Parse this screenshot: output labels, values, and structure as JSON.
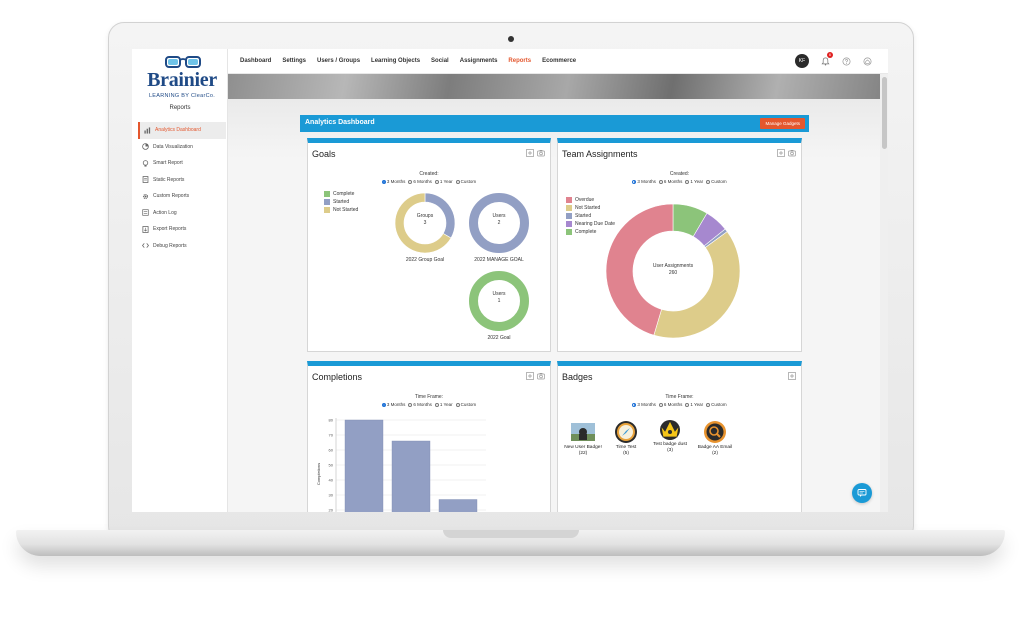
{
  "brand": {
    "name": "Brainier",
    "tagline": "LEARNING BY ClearCo."
  },
  "sidebar": {
    "title": "Reports",
    "items": [
      {
        "label": "Analytics Dashboard",
        "icon": "bar-chart-icon",
        "active": true
      },
      {
        "label": "Data Visualization",
        "icon": "pie-chart-icon"
      },
      {
        "label": "Smart Report",
        "icon": "lightbulb-icon"
      },
      {
        "label": "Static Reports",
        "icon": "document-icon"
      },
      {
        "label": "Custom Reports",
        "icon": "gear-icon"
      },
      {
        "label": "Action Log",
        "icon": "list-icon"
      },
      {
        "label": "Export Reports",
        "icon": "export-icon"
      },
      {
        "label": "Debug Reports",
        "icon": "code-icon"
      }
    ]
  },
  "nav": {
    "items": [
      "Dashboard",
      "Settings",
      "Users / Groups",
      "Learning Objects",
      "Social",
      "Assignments",
      "Reports",
      "Ecommerce"
    ],
    "active": "Reports",
    "avatar_initials": "KF",
    "notification_count": "6"
  },
  "dashboard": {
    "title": "Analytics Dashboard",
    "manage_label": "Manage Gadgets"
  },
  "goals": {
    "title": "Goals",
    "filter_label": "Created:",
    "filters": [
      "3 Months",
      "6 Months",
      "1 Year",
      "Custom"
    ],
    "legend": [
      {
        "label": "Complete",
        "color": "#8cc47a"
      },
      {
        "label": "Started",
        "color": "#929fc4"
      },
      {
        "label": "Not Started",
        "color": "#ddcc8a"
      }
    ],
    "donuts": [
      {
        "center_label": "Groups",
        "center_value": "3",
        "caption": "2022 Group Goal",
        "segments": [
          {
            "color": "#929fc4",
            "value": 1
          },
          {
            "color": "#ddcc8a",
            "value": 2
          }
        ]
      },
      {
        "center_label": "Users",
        "center_value": "2",
        "caption": "2022 MANAGE GOAL",
        "segments": [
          {
            "color": "#929fc4",
            "value": 2
          }
        ]
      },
      {
        "center_label": "Users",
        "center_value": "1",
        "caption": "2022 Goal",
        "segments": [
          {
            "color": "#8cc47a",
            "value": 1
          }
        ]
      }
    ]
  },
  "team": {
    "title": "Team Assignments",
    "filter_label": "Created:",
    "filters": [
      "3 Months",
      "6 Months",
      "1 Year",
      "Custom"
    ],
    "legend": [
      {
        "label": "Overdue",
        "color": "#e0838f"
      },
      {
        "label": "Not Started",
        "color": "#ddcc8a"
      },
      {
        "label": "Started",
        "color": "#929fc4"
      },
      {
        "label": "Nearing Due Date",
        "color": "#a688cf"
      },
      {
        "label": "Complete",
        "color": "#8cc47a"
      }
    ],
    "center_label": "User Assignments",
    "center_value": "260",
    "segments": [
      {
        "label": "Complete",
        "color": "#8cc47a",
        "value": 22
      },
      {
        "label": "Nearing Due Date",
        "color": "#a688cf",
        "value": 15
      },
      {
        "label": "Started",
        "color": "#929fc4",
        "value": 2
      },
      {
        "label": "Not Started",
        "color": "#ddcc8a",
        "value": 103
      },
      {
        "label": "Overdue",
        "color": "#e0838f",
        "value": 118
      }
    ]
  },
  "completions": {
    "title": "Completions",
    "filter_label": "Time Frame:",
    "filters": [
      "3 Months",
      "6 Months",
      "1 Year",
      "Custom"
    ],
    "ylabel": "Completions"
  },
  "chart_data": {
    "type": "bar",
    "categories": [
      "",
      "",
      ""
    ],
    "values": [
      80,
      66,
      27
    ],
    "ylabel": "Completions",
    "ylim": [
      0,
      80
    ],
    "yticks": [
      80,
      70,
      60,
      50,
      40,
      30,
      20,
      10
    ],
    "grid": true,
    "color": "#929fc4"
  },
  "badges": {
    "title": "Badges",
    "filter_label": "Time Frame:",
    "filters": [
      "3 Months",
      "6 Months",
      "1 Year",
      "Custom"
    ],
    "items": [
      {
        "name": "New User Badge!",
        "count": "(22)",
        "icon": "new-user-badge-icon"
      },
      {
        "name": "Time Test",
        "count": "(5)",
        "icon": "compass-badge-icon"
      },
      {
        "name": "Test badge dust",
        "count": "(3)",
        "icon": "crown-badge-icon"
      },
      {
        "name": "Badge AA Email",
        "count": "(2)",
        "icon": "magnifier-badge-icon"
      }
    ]
  },
  "colors": {
    "accent": "#1a9ad6",
    "brand_orange": "#e4572e",
    "brand_blue": "#1f4a86"
  }
}
